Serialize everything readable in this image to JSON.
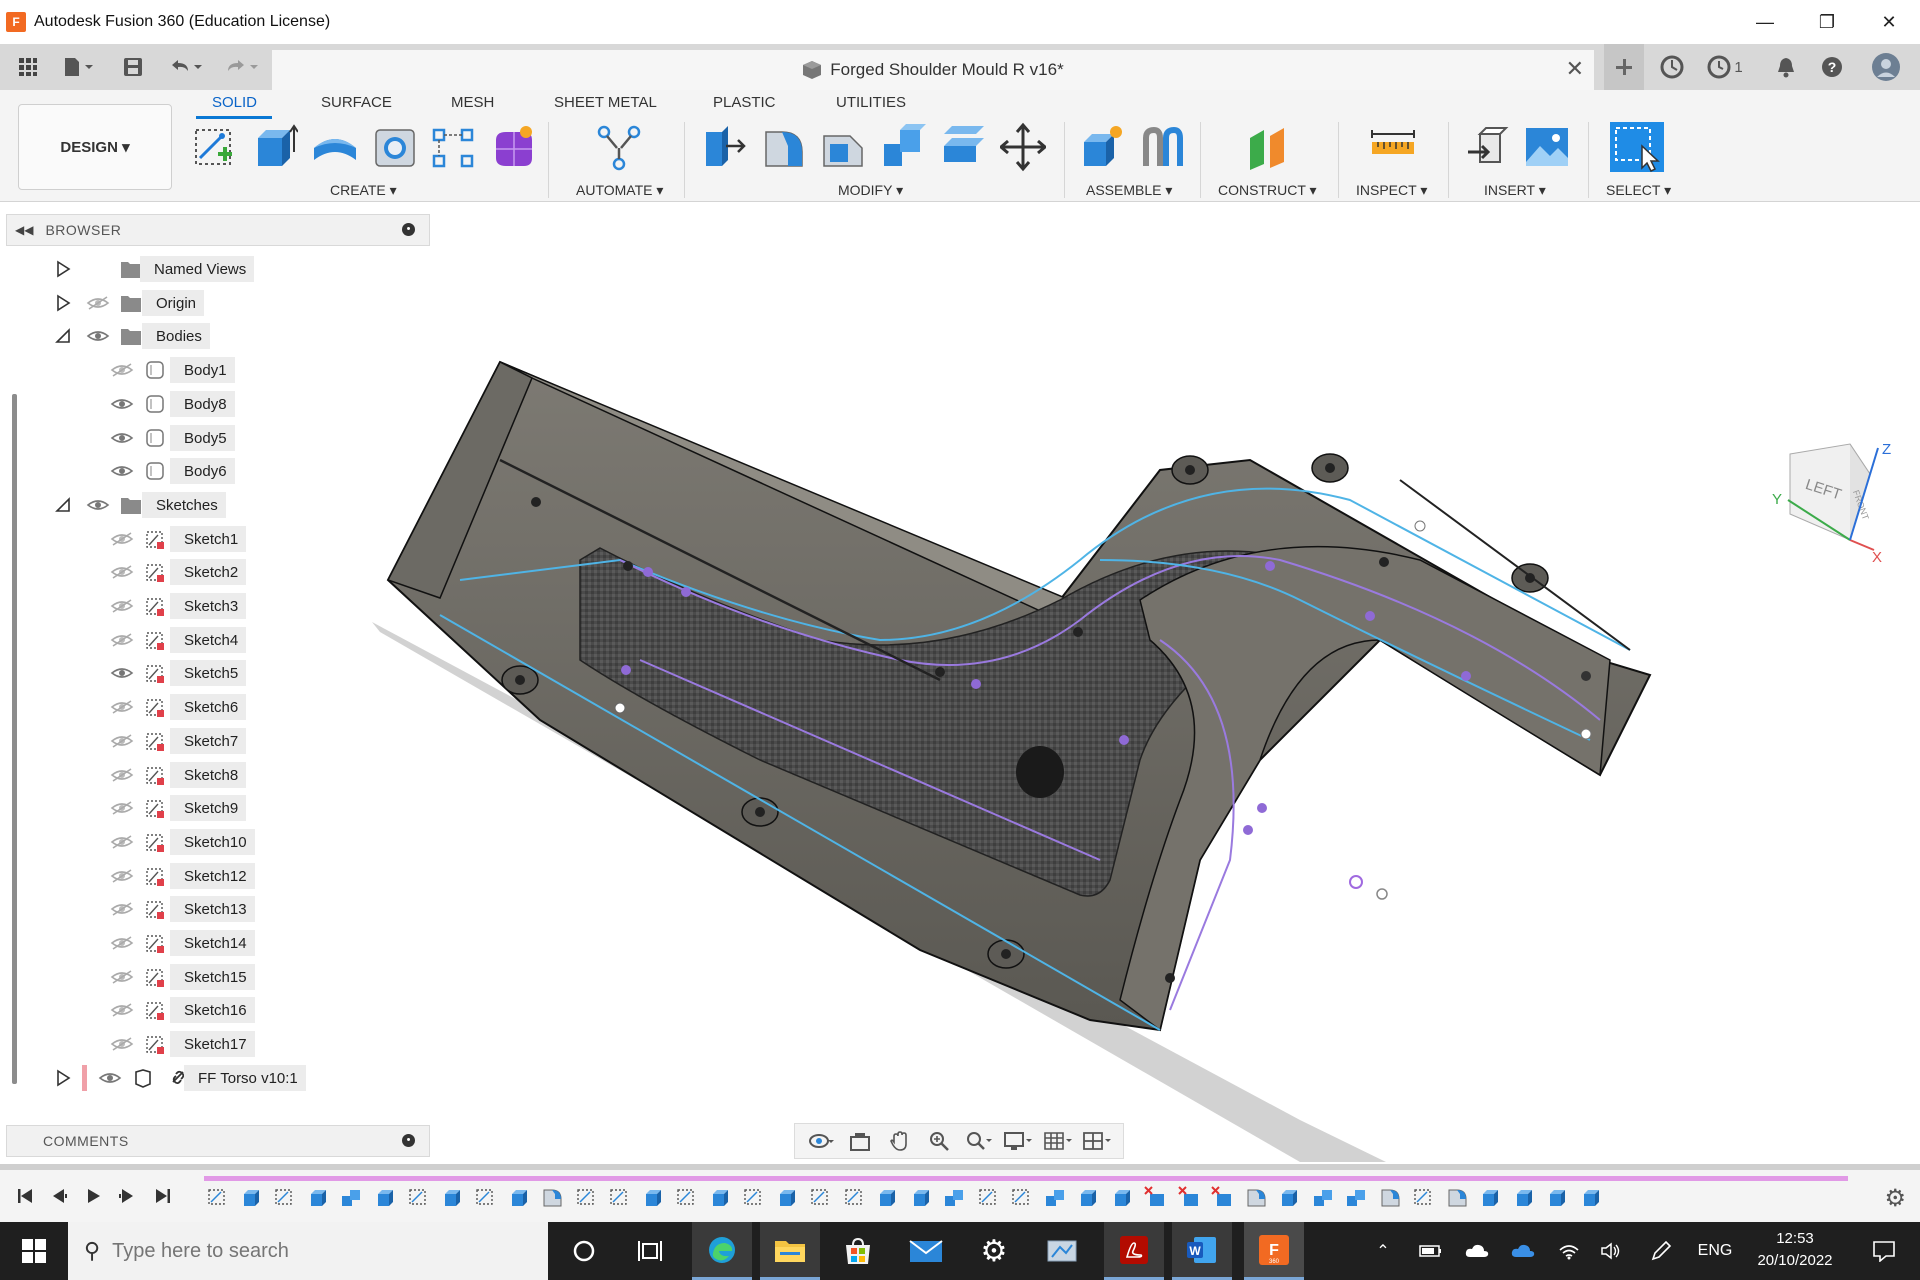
{
  "window": {
    "title": "Autodesk Fusion 360 (Education License)",
    "logo_letter": "F"
  },
  "document": {
    "name": "Forged Shoulder Mould R v16*"
  },
  "appbar": {
    "job_count": "1"
  },
  "ribbon": {
    "workspace": "DESIGN ▾",
    "tabs": [
      "SOLID",
      "SURFACE",
      "MESH",
      "SHEET METAL",
      "PLASTIC",
      "UTILITIES"
    ],
    "active_tab": "SOLID",
    "groups": {
      "create": "CREATE ▾",
      "automate": "AUTOMATE ▾",
      "modify": "MODIFY ▾",
      "assemble": "ASSEMBLE ▾",
      "construct": "CONSTRUCT ▾",
      "inspect": "INSPECT ▾",
      "insert": "INSERT ▾",
      "select": "SELECT ▾"
    }
  },
  "browser": {
    "title": "BROWSER",
    "folders": {
      "named_views": "Named Views",
      "origin": "Origin",
      "bodies": "Bodies",
      "sketches": "Sketches"
    },
    "bodies": [
      {
        "name": "Body1",
        "visible": false
      },
      {
        "name": "Body8",
        "visible": true
      },
      {
        "name": "Body5",
        "visible": true
      },
      {
        "name": "Body6",
        "visible": true
      }
    ],
    "sketches": [
      {
        "name": "Sketch1",
        "visible": false
      },
      {
        "name": "Sketch2",
        "visible": false
      },
      {
        "name": "Sketch3",
        "visible": false
      },
      {
        "name": "Sketch4",
        "visible": false
      },
      {
        "name": "Sketch5",
        "visible": true
      },
      {
        "name": "Sketch6",
        "visible": false
      },
      {
        "name": "Sketch7",
        "visible": false
      },
      {
        "name": "Sketch8",
        "visible": false
      },
      {
        "name": "Sketch9",
        "visible": false
      },
      {
        "name": "Sketch10",
        "visible": false
      },
      {
        "name": "Sketch12",
        "visible": false
      },
      {
        "name": "Sketch13",
        "visible": false
      },
      {
        "name": "Sketch14",
        "visible": false
      },
      {
        "name": "Sketch15",
        "visible": false
      },
      {
        "name": "Sketch16",
        "visible": false
      },
      {
        "name": "Sketch17",
        "visible": false
      }
    ],
    "component": "FF Torso v10:1"
  },
  "viewcube": {
    "left": "LEFT",
    "front": "FRONT",
    "axis_x": "X",
    "axis_y": "Y",
    "axis_z": "Z"
  },
  "comments": {
    "title": "COMMENTS"
  },
  "taskbar": {
    "search_placeholder": "Type here to search",
    "language": "ENG",
    "time": "12:53",
    "date": "20/10/2022"
  },
  "colors": {
    "accent": "#0a78d4",
    "timeline_bar": "#e199e6",
    "fusion_orange": "#f26a22",
    "taskbar": "#1f1f1f"
  }
}
